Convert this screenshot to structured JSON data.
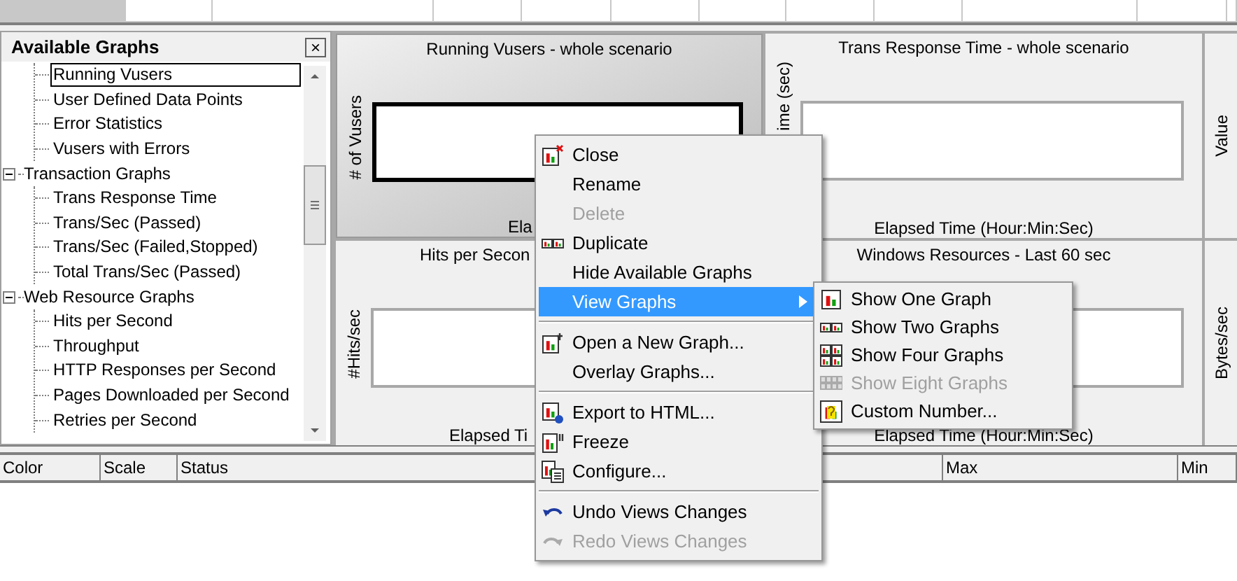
{
  "panel": {
    "title": "Available Graphs",
    "close": "×"
  },
  "tree": {
    "continued_items": [
      {
        "label": "Running Vusers",
        "selected": true
      },
      {
        "label": "User Defined Data Points",
        "selected": false
      },
      {
        "label": "Error Statistics",
        "selected": false
      },
      {
        "label": "Vusers with Errors",
        "selected": false
      }
    ],
    "groups": [
      {
        "label": "Transaction Graphs",
        "expanded": true,
        "children": [
          {
            "label": "Trans Response Time",
            "selected": false
          },
          {
            "label": "Trans/Sec (Passed)",
            "selected": false
          },
          {
            "label": "Trans/Sec (Failed,Stopped)",
            "selected": false
          },
          {
            "label": "Total Trans/Sec (Passed)",
            "selected": false
          }
        ]
      },
      {
        "label": "Web Resource Graphs",
        "expanded": true,
        "children": [
          {
            "label": "Hits per Second",
            "selected": false
          },
          {
            "label": "Throughput",
            "selected": false
          },
          {
            "label": "HTTP Responses per Second",
            "selected": false
          },
          {
            "label": "Pages Downloaded per Second",
            "selected": false
          },
          {
            "label": "Retries per Second",
            "selected": false
          }
        ]
      }
    ]
  },
  "graphs": [
    {
      "title": "Running Vusers - whole scenario",
      "y_label": "# of Vusers",
      "x_label": "Ela",
      "selected": true
    },
    {
      "title": "Trans Response Time - whole scenario",
      "y_label": "ime (sec)",
      "x_label": "Elapsed Time (Hour:Min:Sec)",
      "selected": false
    },
    {
      "title": "Hits per Secon",
      "y_label": "#Hits/sec",
      "x_label": "Elapsed Ti",
      "selected": false
    },
    {
      "title": "Windows Resources - Last 60 sec",
      "x_label": "Elapsed Time (Hour:Min:Sec)",
      "selected": false
    }
  ],
  "side_axis_labels": [
    "Value",
    "Bytes/sec"
  ],
  "legend_columns": [
    "Color",
    "Scale",
    "Status",
    "Max",
    "Min"
  ],
  "context_menu": [
    {
      "kind": "item",
      "label": "Close",
      "disabled": false,
      "selected": false,
      "has_submenu": false
    },
    {
      "kind": "item",
      "label": "Rename",
      "disabled": false,
      "selected": false,
      "has_submenu": false
    },
    {
      "kind": "item",
      "label": "Delete",
      "disabled": true,
      "selected": false,
      "has_submenu": false
    },
    {
      "kind": "item",
      "label": "Duplicate",
      "disabled": false,
      "selected": false,
      "has_submenu": false
    },
    {
      "kind": "item",
      "label": "Hide Available Graphs",
      "disabled": false,
      "selected": false,
      "has_submenu": false
    },
    {
      "kind": "item",
      "label": "View Graphs",
      "disabled": false,
      "selected": true,
      "has_submenu": true
    },
    {
      "kind": "separator"
    },
    {
      "kind": "item",
      "label": "Open a New Graph...",
      "disabled": false,
      "selected": false,
      "has_submenu": false
    },
    {
      "kind": "item",
      "label": "Overlay Graphs...",
      "disabled": false,
      "selected": false,
      "has_submenu": false
    },
    {
      "kind": "separator"
    },
    {
      "kind": "item",
      "label": "Export to HTML...",
      "disabled": false,
      "selected": false,
      "has_submenu": false
    },
    {
      "kind": "item",
      "label": "Freeze",
      "disabled": false,
      "selected": false,
      "has_submenu": false
    },
    {
      "kind": "item",
      "label": "Configure...",
      "disabled": false,
      "selected": false,
      "has_submenu": false
    },
    {
      "kind": "separator"
    },
    {
      "kind": "item",
      "label": "Undo Views Changes",
      "disabled": false,
      "selected": false,
      "has_submenu": false
    },
    {
      "kind": "item",
      "label": "Redo Views Changes",
      "disabled": true,
      "selected": false,
      "has_submenu": false
    }
  ],
  "submenu": [
    {
      "label": "Show One Graph",
      "disabled": false,
      "selected": false
    },
    {
      "label": "Show Two Graphs",
      "disabled": false,
      "selected": false
    },
    {
      "label": "Show Four Graphs",
      "disabled": false,
      "selected": false
    },
    {
      "label": "Show Eight Graphs",
      "disabled": true,
      "selected": false
    },
    {
      "label": "Custom Number...",
      "disabled": false,
      "selected": false
    }
  ]
}
